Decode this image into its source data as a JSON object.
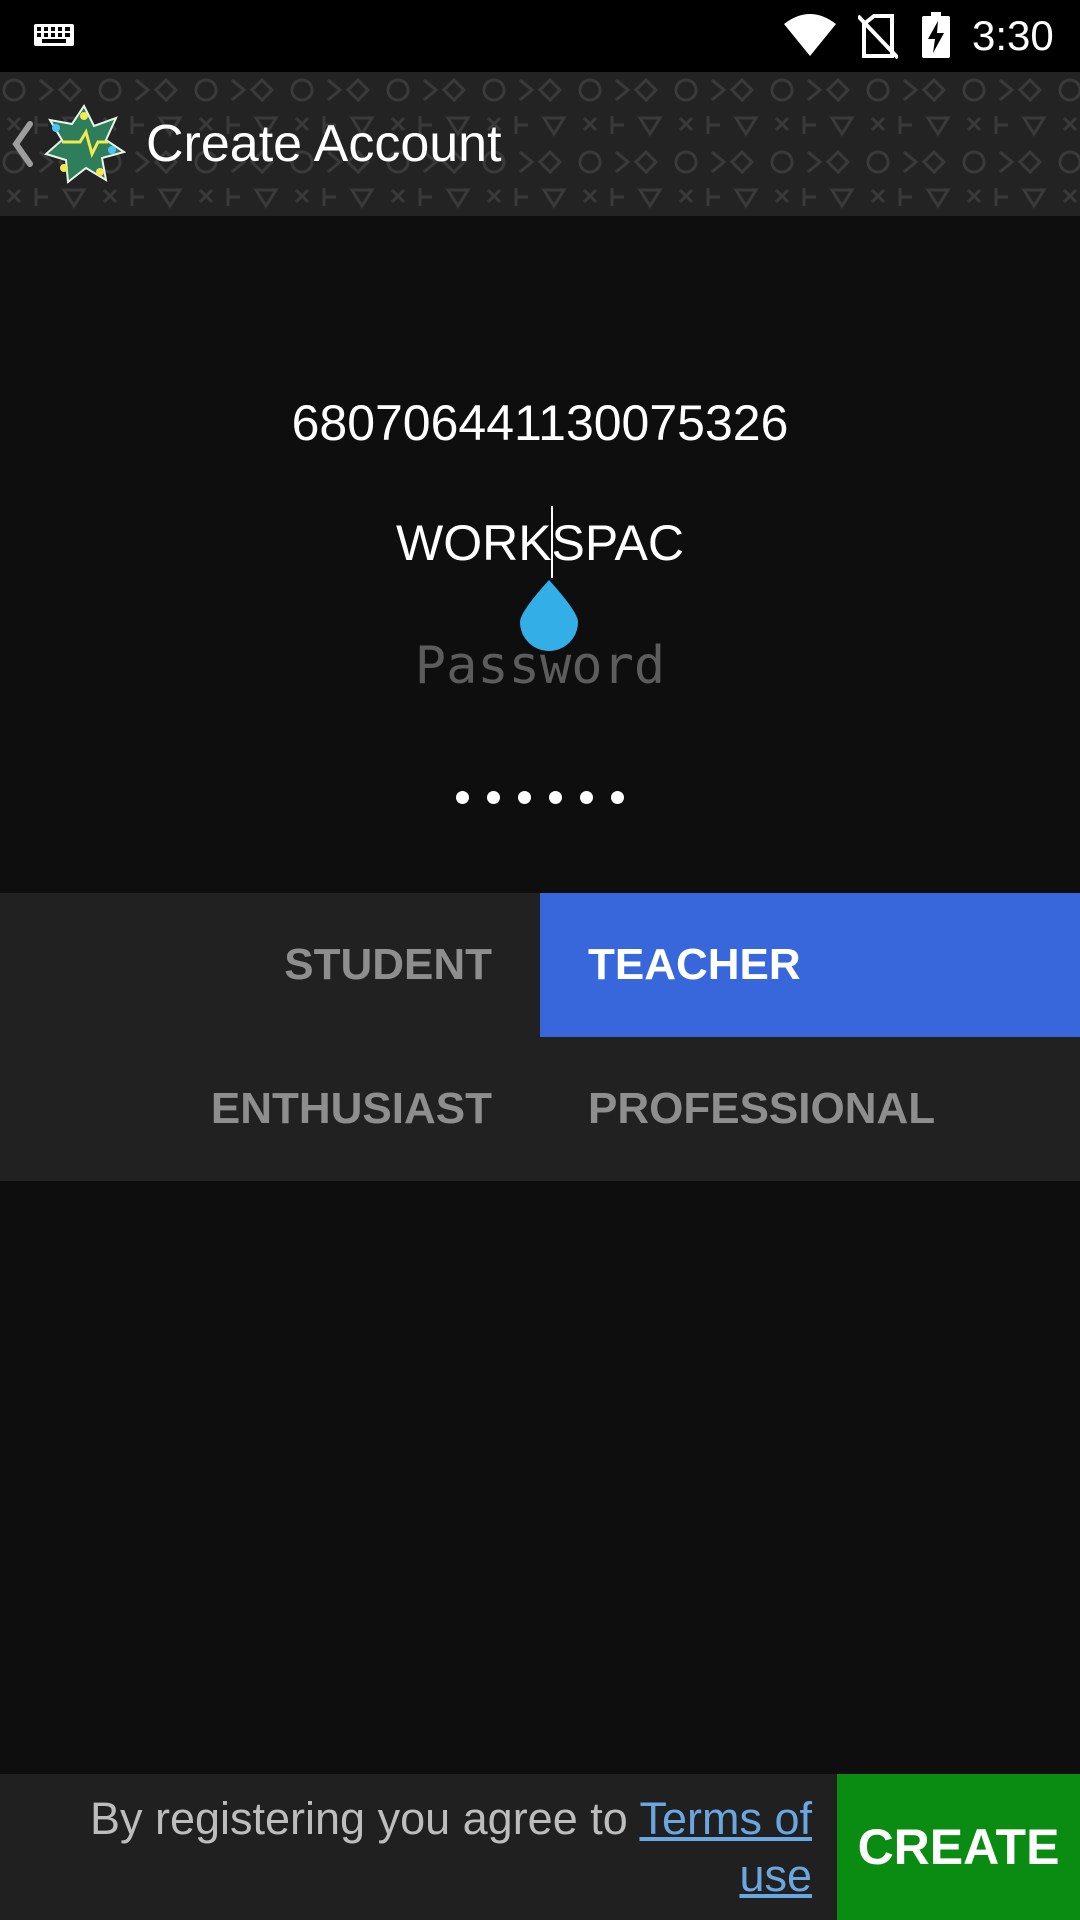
{
  "status_bar": {
    "time": "3:30",
    "icons": [
      "keyboard-icon",
      "wifi-icon",
      "no-sim-icon",
      "battery-charging-icon"
    ]
  },
  "app_bar": {
    "title": "Create Account",
    "back_icon": "chevron-left-icon",
    "logo_icon": "app-logo-icon"
  },
  "form": {
    "account_id": "680706441130075326",
    "workspace_value": "WORKSPAC",
    "password_placeholder": "Password",
    "password_value": "••••••"
  },
  "roles": {
    "items": [
      {
        "label": "STUDENT",
        "selected": false
      },
      {
        "label": "TEACHER",
        "selected": true
      },
      {
        "label": "ENTHUSIAST",
        "selected": false
      },
      {
        "label": "PROFESSIONAL",
        "selected": false
      }
    ],
    "selected_color": "#3867dc"
  },
  "footer": {
    "terms_prefix": "By registering you agree to ",
    "terms_link": "Terms of use",
    "create_label": "CREATE",
    "create_color": "#0a8c12",
    "link_color": "#6aa6e0"
  },
  "colors": {
    "background": "#0e0e0e",
    "panel": "#212121",
    "cursor_handle": "#33aee6"
  }
}
